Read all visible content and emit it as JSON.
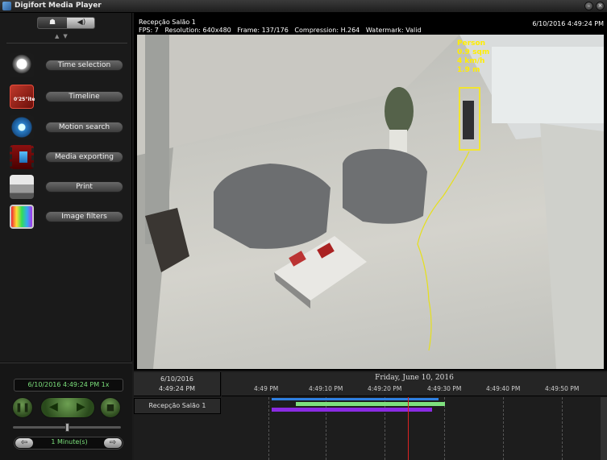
{
  "window": {
    "title": "Digifort Media Player"
  },
  "sidebar": {
    "tools": [
      {
        "label": "Time selection"
      },
      {
        "label": "Timeline",
        "icon_text": "0'25\"ite"
      },
      {
        "label": "Motion search"
      },
      {
        "label": "Media exporting"
      },
      {
        "label": "Print"
      },
      {
        "label": "Image filters"
      }
    ]
  },
  "controls": {
    "current_time": "6/10/2016 4:49:24 PM 1x",
    "zoom_label": "1 Minute(s)",
    "speed_position": 0.5
  },
  "video": {
    "camera_name": "Recepção Salão 1",
    "datetime": "6/10/2016 4:49:24 PM",
    "stats": "FPS: 7   Resolution: 640x480   Frame: 137/176   Compression: H.264   Watermark: Valid",
    "analytics": {
      "class": "Person",
      "area": "0.9 sqm",
      "speed": "4 km/h",
      "height": "1.9 m"
    }
  },
  "timeline": {
    "date": "6/10/2016",
    "time": "4:49:24 PM",
    "day_title": "Friday, June 10, 2016",
    "ticks": [
      "4:49 PM",
      "4:49:10 PM",
      "4:49:20 PM",
      "4:49:30 PM",
      "4:49:40 PM",
      "4:49:50 PM"
    ],
    "camera_row": "Recepção Salão 1",
    "colors": {
      "recording": "#2f7fe0",
      "motion": "#7ee07e",
      "event": "#8a2be2",
      "cursor": "#dd2222"
    }
  }
}
